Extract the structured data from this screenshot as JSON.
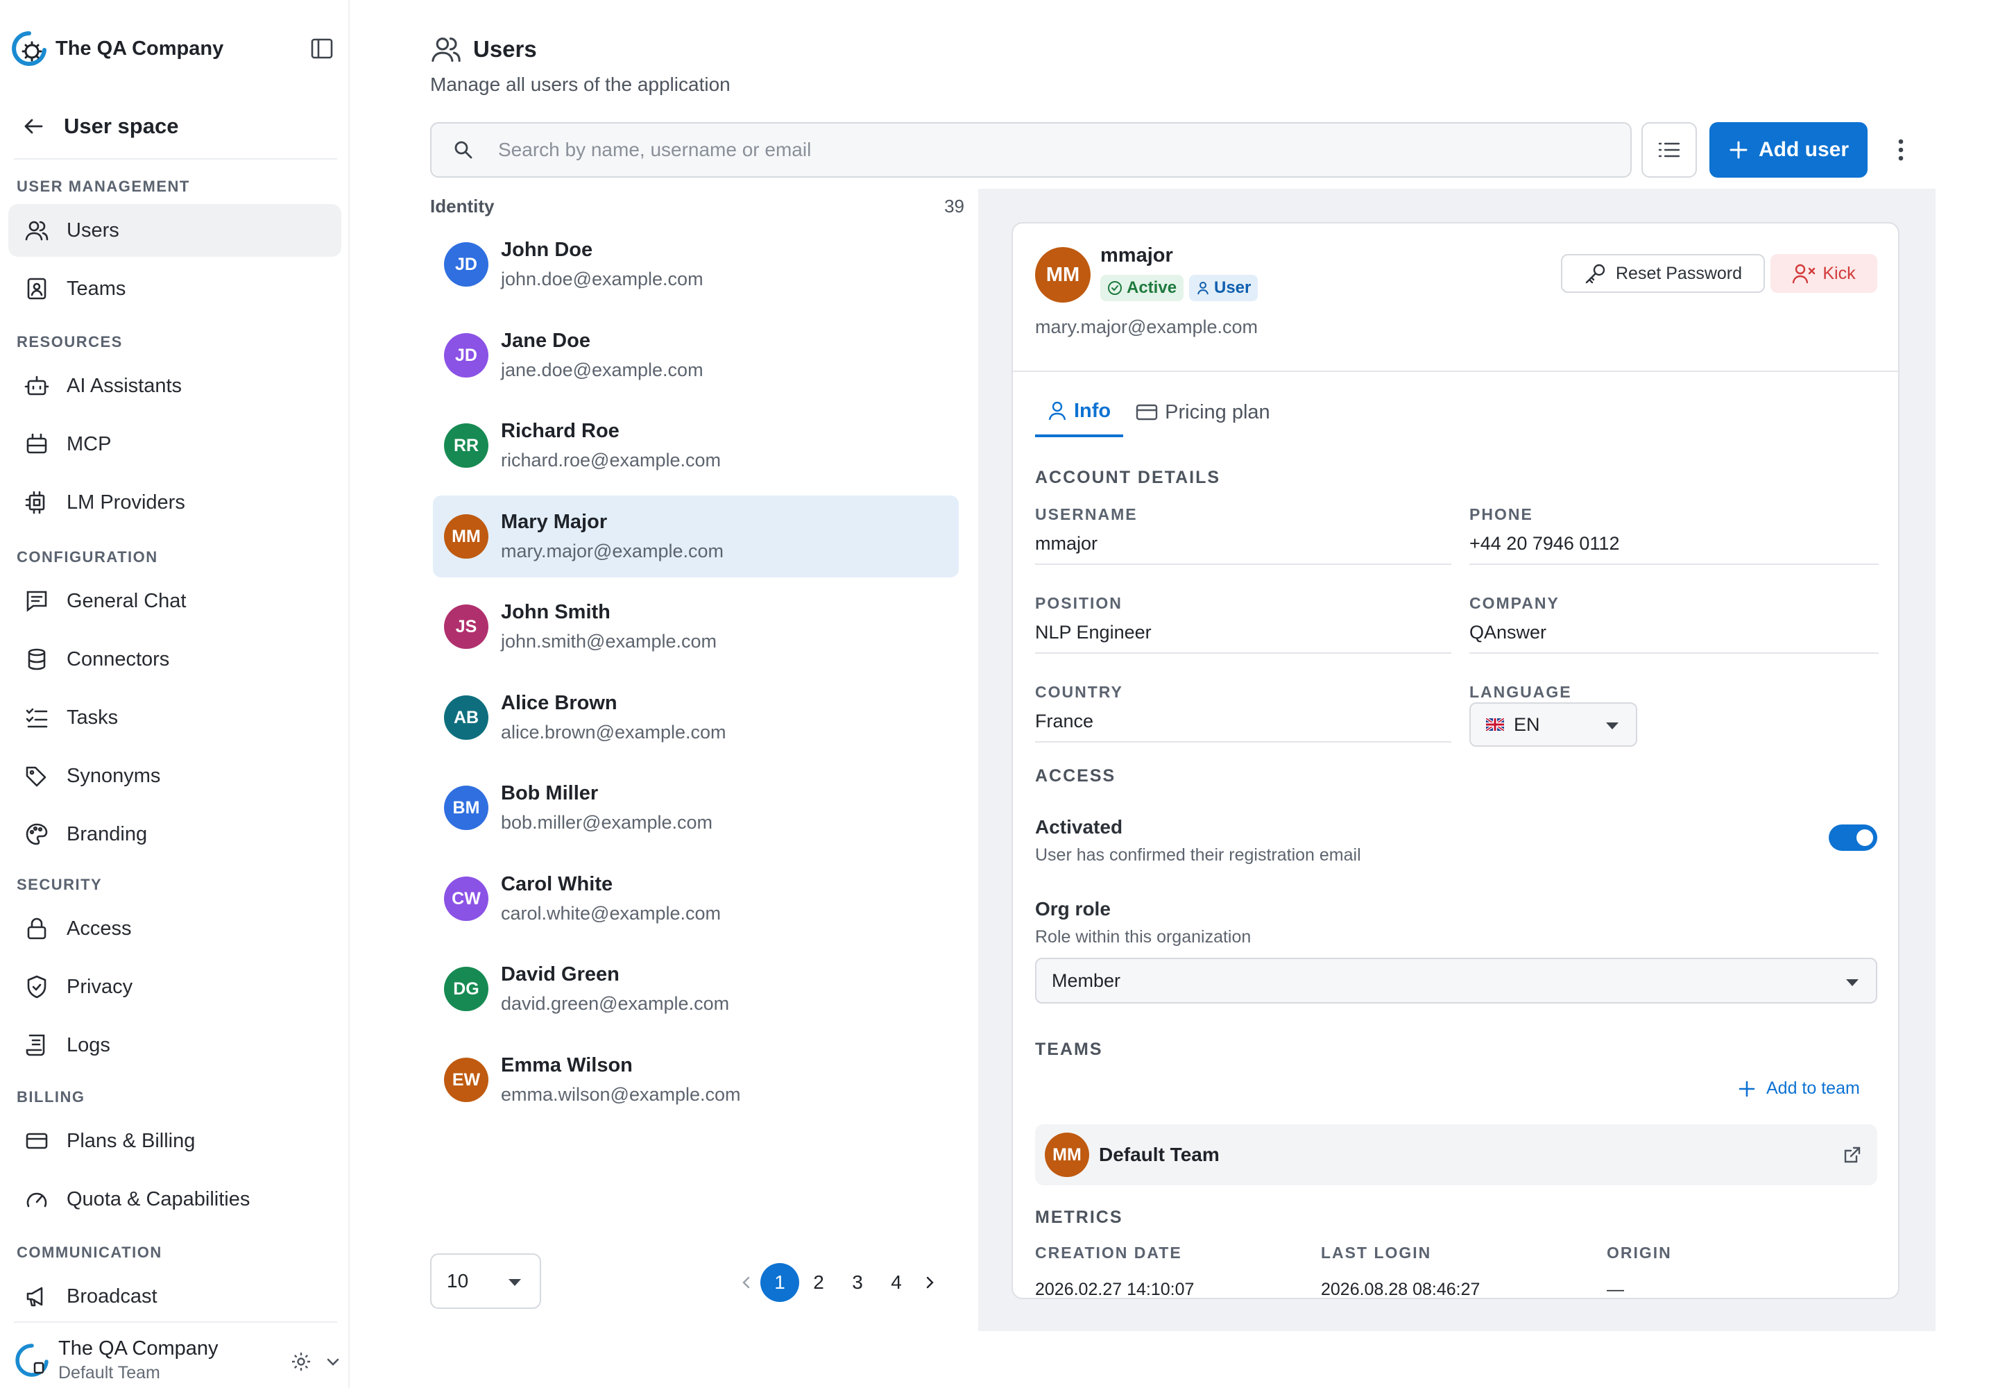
{
  "brand": {
    "name": "The QA Company"
  },
  "sidebar": {
    "back_label": "User space",
    "sections": [
      {
        "title": "USER MANAGEMENT",
        "items": [
          {
            "label": "Users",
            "icon": "users-icon",
            "active": true
          },
          {
            "label": "Teams",
            "icon": "teams-icon"
          }
        ]
      },
      {
        "title": "RESOURCES",
        "items": [
          {
            "label": "AI Assistants",
            "icon": "bot-icon"
          },
          {
            "label": "MCP",
            "icon": "mcp-icon"
          },
          {
            "label": "LM Providers",
            "icon": "cpu-icon"
          }
        ]
      },
      {
        "title": "CONFIGURATION",
        "items": [
          {
            "label": "General Chat",
            "icon": "chat-icon"
          },
          {
            "label": "Connectors",
            "icon": "database-icon"
          },
          {
            "label": "Tasks",
            "icon": "tasks-icon"
          },
          {
            "label": "Synonyms",
            "icon": "tag-icon"
          },
          {
            "label": "Branding",
            "icon": "palette-icon"
          }
        ]
      },
      {
        "title": "SECURITY",
        "items": [
          {
            "label": "Access",
            "icon": "lock-icon"
          },
          {
            "label": "Privacy",
            "icon": "shield-icon"
          },
          {
            "label": "Logs",
            "icon": "scroll-icon"
          }
        ]
      },
      {
        "title": "BILLING",
        "items": [
          {
            "label": "Plans & Billing",
            "icon": "credit-card-icon"
          },
          {
            "label": "Quota & Capabilities",
            "icon": "gauge-icon"
          }
        ]
      },
      {
        "title": "COMMUNICATION",
        "items": [
          {
            "label": "Broadcast",
            "icon": "megaphone-icon"
          }
        ]
      }
    ],
    "footer": {
      "org_name": "The QA Company",
      "team_name": "Default Team"
    }
  },
  "header": {
    "title": "Users",
    "subtitle": "Manage all users of the application",
    "search_placeholder": "Search by name, username or email",
    "add_user_label": "Add user"
  },
  "list": {
    "column_title": "Identity",
    "count": "39",
    "users": [
      {
        "initials": "JD",
        "name": "John Doe",
        "email": "john.doe@example.com",
        "color": "#2f6fe0"
      },
      {
        "initials": "JD",
        "name": "Jane Doe",
        "email": "jane.doe@example.com",
        "color": "#8b52e6"
      },
      {
        "initials": "RR",
        "name": "Richard Roe",
        "email": "richard.roe@example.com",
        "color": "#168a52"
      },
      {
        "initials": "MM",
        "name": "Mary Major",
        "email": "mary.major@example.com",
        "color": "#bf5a10",
        "selected": true
      },
      {
        "initials": "JS",
        "name": "John Smith",
        "email": "john.smith@example.com",
        "color": "#b0306d"
      },
      {
        "initials": "AB",
        "name": "Alice Brown",
        "email": "alice.brown@example.com",
        "color": "#0e6e7e"
      },
      {
        "initials": "BM",
        "name": "Bob Miller",
        "email": "bob.miller@example.com",
        "color": "#2f6fe0"
      },
      {
        "initials": "CW",
        "name": "Carol White",
        "email": "carol.white@example.com",
        "color": "#8b52e6"
      },
      {
        "initials": "DG",
        "name": "David Green",
        "email": "david.green@example.com",
        "color": "#168a52"
      },
      {
        "initials": "EW",
        "name": "Emma Wilson",
        "email": "emma.wilson@example.com",
        "color": "#bf5a10"
      }
    ],
    "page_size": "10",
    "pages": [
      "1",
      "2",
      "3",
      "4"
    ],
    "current_page": "1"
  },
  "detail": {
    "initials": "MM",
    "username": "mmajor",
    "status_badge": "Active",
    "role_badge": "User",
    "email": "mary.major@example.com",
    "reset_password_label": "Reset Password",
    "kick_label": "Kick",
    "tabs": [
      "Info",
      "Pricing plan"
    ],
    "account_details_title": "ACCOUNT DETAILS",
    "fields": {
      "username_label": "USERNAME",
      "username": "mmajor",
      "phone_label": "PHONE",
      "phone": "+44 20 7946 0112",
      "position_label": "POSITION",
      "position": "NLP Engineer",
      "company_label": "COMPANY",
      "company": "QAnswer",
      "country_label": "COUNTRY",
      "country": "France",
      "language_label": "LANGUAGE",
      "language": "EN"
    },
    "access_title": "ACCESS",
    "activated_title": "Activated",
    "activated_desc": "User has confirmed their registration email",
    "activated": true,
    "org_role_title": "Org role",
    "org_role_desc": "Role within this organization",
    "org_role": "Member",
    "teams_title": "TEAMS",
    "add_to_team_label": "Add to team",
    "team": {
      "initials": "MM",
      "name": "Default Team"
    },
    "metrics_title": "METRICS",
    "metrics": {
      "creation_label": "CREATION DATE",
      "creation": "2026.02.27 14:10:07",
      "login_label": "LAST LOGIN",
      "login": "2026.08.28 08:46:27",
      "origin_label": "ORIGIN",
      "origin": "—"
    }
  },
  "colors": {
    "accent": "#0d72d2",
    "danger": "#d23a3a",
    "success": "#1e7a3e",
    "selected_row": "#e3eef9"
  }
}
